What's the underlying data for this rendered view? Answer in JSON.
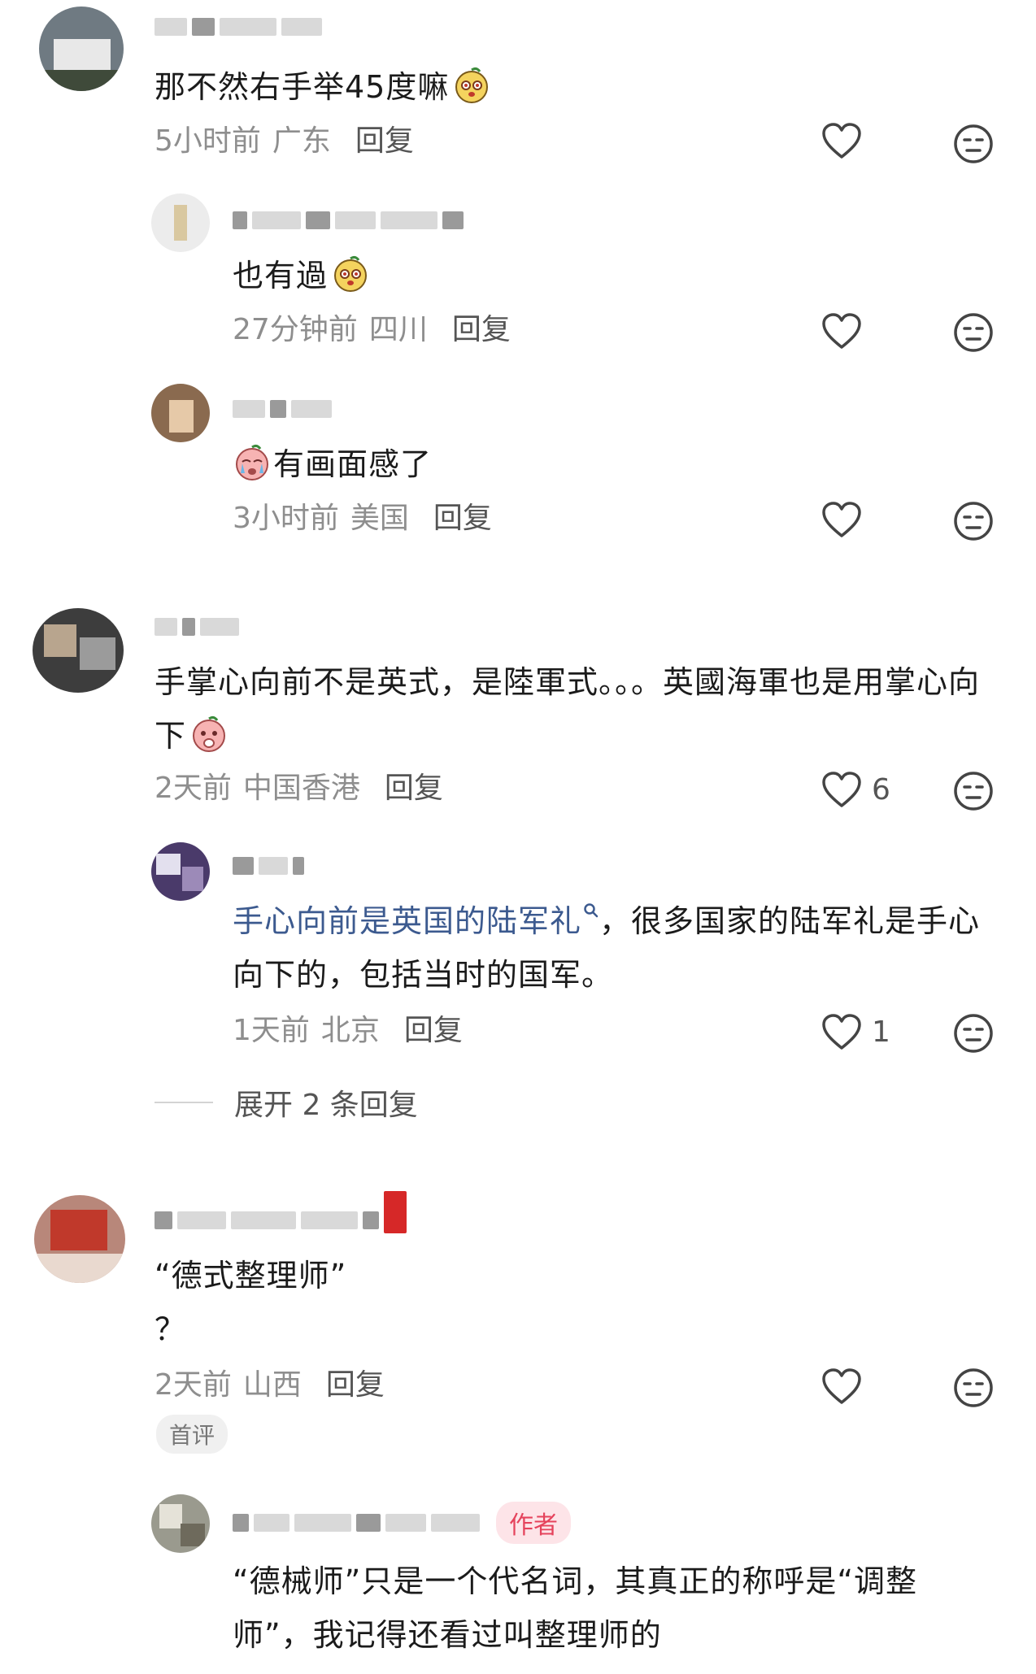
{
  "comments": [
    {
      "text": "那不然右手举45度嘛",
      "time": "5小时前",
      "location": "广东",
      "reply": "回复",
      "likes": ""
    },
    {
      "text": "也有過",
      "time": "27分钟前",
      "location": "四川",
      "reply": "回复",
      "likes": ""
    },
    {
      "text": "有画面感了",
      "time": "3小时前",
      "location": "美国",
      "reply": "回复",
      "likes": ""
    },
    {
      "text": "手掌心向前不是英式，是陸軍式。。。英國海軍也是用掌心向下",
      "time": "2天前",
      "location": "中国香港",
      "reply": "回复",
      "likes": "6"
    },
    {
      "link_text": "手心向前是英国的陆军礼",
      "text": "，很多国家的陆军礼是手心向下的，包括当时的国军。",
      "time": "1天前",
      "location": "北京",
      "reply": "回复",
      "likes": "1"
    },
    {
      "text": "“德式整理师”\n？",
      "time": "2天前",
      "location": "山西",
      "reply": "回复",
      "likes": "",
      "badge": "首评"
    },
    {
      "text": "“德械师”只是一个代名词，其真正的称呼是“调整师”，我记得还看过叫整理师的",
      "author_badge": "作者"
    }
  ],
  "expand_replies": "展开 2 条回复",
  "colors": {
    "link": "#3c5a8f",
    "author_badge_text": "#e5435c",
    "author_badge_bg": "#fde4e8",
    "meta": "#8e8e8e"
  },
  "icons": [
    "heart-icon",
    "neutral-face-icon",
    "emoji-sticker",
    "search-link-icon"
  ]
}
